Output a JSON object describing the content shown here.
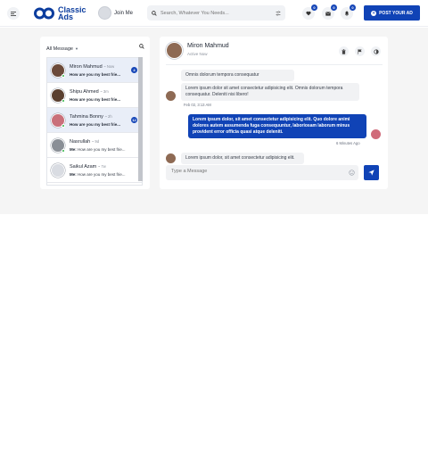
{
  "brand": {
    "logo_text": "Classic Ads",
    "accent": "#1043b6"
  },
  "header": {
    "join_label": "Join Me",
    "search_placeholder": "Search, Whatever You Needs...",
    "favorites_count": "0",
    "messages_count": "0",
    "notifications_count": "0",
    "post_ad_label": "POST YOUR AD"
  },
  "sidebar": {
    "filter_label": "All Message",
    "contacts": [
      {
        "name": "Miron Mahmud",
        "time": "~ Now",
        "sender": "",
        "preview": "How are you my best frie...",
        "unread": "4",
        "active": true,
        "online": true
      },
      {
        "name": "Shipu Ahmed",
        "time": "~ 3m",
        "sender": "",
        "preview": "How are you my best frie...",
        "unread": "",
        "active": false,
        "online": true
      },
      {
        "name": "Tahmina Bonny",
        "time": "~ 2h",
        "sender": "",
        "preview": "How are you my best frie...",
        "unread": "12",
        "active": true,
        "online": true
      },
      {
        "name": "Nasrullah",
        "time": "~ 9d",
        "sender": "Me:",
        "preview": "How are you my best frie...",
        "unread": "",
        "active": false,
        "online": true
      },
      {
        "name": "Saikul Azam",
        "time": "~ 7w",
        "sender": "Me:",
        "preview": "How are you my best frie...",
        "unread": "",
        "active": false,
        "online": false
      }
    ]
  },
  "chat": {
    "name": "Miron Mahmud",
    "status": "Active Now",
    "messages": {
      "m1": "Omnis dolorum tempora consequatur",
      "m2": "Lorem ipsum dolor sit amet consectetur adipisicing elit. Omnis dolorum tempora consequatur. Deleniti nisi libero!",
      "m2_time": "Feb 02, 3:13 AM",
      "m3": "Lorem ipsum dolor, sit amet consectetur adipisicing elit. Quo dolore animi dolores autem assumenda fuga consequuntur, laboriosam laborum minus provident error officia quasi atque deleniti.",
      "m3_time": "6 Minutes Ago",
      "m4": "Lorem ipsum dolor, sit amet consectetur adipisicing elit."
    },
    "composer_placeholder": "Type a Message"
  }
}
